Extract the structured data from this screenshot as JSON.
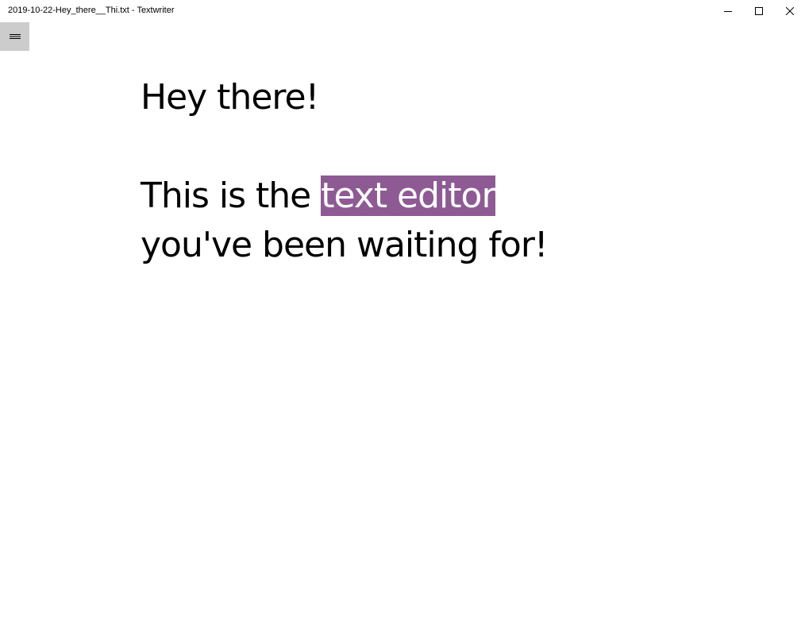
{
  "window": {
    "title": "2019-10-22-Hey_there__Thi.txt - Textwriter",
    "controls": {
      "minimize_icon": "minimize-icon",
      "maximize_icon": "maximize-icon",
      "close_icon": "close-icon"
    }
  },
  "toolbar": {
    "menu_icon": "hamburger-menu-icon"
  },
  "editor": {
    "line1": "Hey there!",
    "line2": "",
    "line3_before_selection": "This is the ",
    "line3_selection": "text editor",
    "line4": "you've been waiting for!"
  },
  "colors": {
    "selection_background": "#8e5a94",
    "selection_text": "#ffffff",
    "menu_button_background": "#cccccc"
  }
}
